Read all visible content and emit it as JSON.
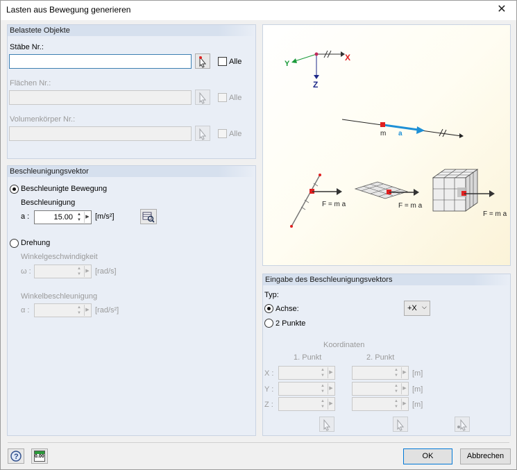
{
  "window": {
    "title": "Lasten aus Bewegung generieren",
    "close_glyph": "✕"
  },
  "loaded_objects": {
    "header": "Belastete Objekte",
    "members_label": "Stäbe Nr.:",
    "members_value": "",
    "surfaces_label": "Flächen Nr.:",
    "surfaces_value": "",
    "solids_label": "Volumenkörper Nr.:",
    "solids_value": "",
    "all_label": "Alle"
  },
  "accel_vector": {
    "header": "Beschleunigungsvektor",
    "accelerated_motion": "Beschleunigte Bewegung",
    "acceleration_label": "Beschleunigung",
    "a_symbol": "a :",
    "a_value": "15.00",
    "a_unit": "[m/s²]",
    "rotation": "Drehung",
    "angular_velocity_label": "Winkelgeschwindigkeit",
    "omega_symbol": "ω :",
    "omega_value": "",
    "omega_unit": "[rad/s]",
    "angular_accel_label": "Winkelbeschleunigung",
    "alpha_symbol": "α :",
    "alpha_value": "",
    "alpha_unit": "[rad/s²]"
  },
  "diagram": {
    "axis_x": "X",
    "axis_y": "Y",
    "axis_z": "Z",
    "m_label": "m",
    "a_label": "a",
    "force1": "F = m a",
    "force2": "F = m a",
    "force3": "F = m a"
  },
  "vector_input": {
    "header": "Eingabe des Beschleunigungsvektors",
    "type_label": "Typ:",
    "axis_option": "Achse:",
    "axis_value": "+X",
    "two_points_option": "2 Punkte",
    "coords_label": "Koordinaten",
    "point1_label": "1. Punkt",
    "point2_label": "2. Punkt",
    "x_label": "X :",
    "y_label": "Y :",
    "z_label": "Z :",
    "unit": "[m]"
  },
  "footer": {
    "ok": "OK",
    "cancel": "Abbrechen",
    "units_icon_text": "0.00"
  },
  "colors": {
    "accent_blue": "#1e90d6",
    "red": "#e02020",
    "navy": "#1f2a8a",
    "green": "#1a9a3a"
  }
}
